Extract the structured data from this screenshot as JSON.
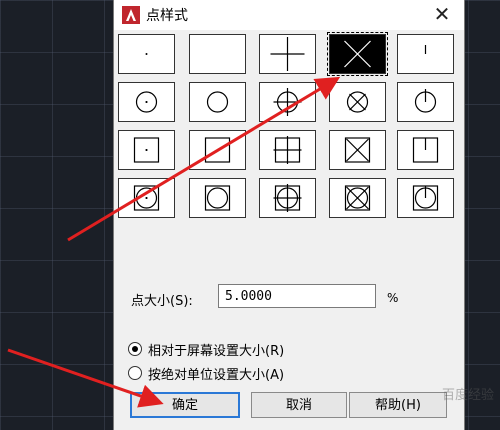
{
  "dialog": {
    "title": "点样式",
    "close_glyph": "✕",
    "icon": "autocad-logo-icon",
    "brand_color": "#c0262d"
  },
  "point_styles": [
    {
      "style": "dot",
      "selected": false
    },
    {
      "style": "none",
      "selected": false
    },
    {
      "style": "plus",
      "selected": false
    },
    {
      "style": "x",
      "selected": true
    },
    {
      "style": "tick",
      "selected": false
    },
    {
      "style": "circle-dot",
      "selected": false
    },
    {
      "style": "circle",
      "selected": false
    },
    {
      "style": "circle-plus",
      "selected": false
    },
    {
      "style": "circle-x",
      "selected": false
    },
    {
      "style": "circle-tick",
      "selected": false
    },
    {
      "style": "square-dot",
      "selected": false
    },
    {
      "style": "square",
      "selected": false
    },
    {
      "style": "square-plus",
      "selected": false
    },
    {
      "style": "square-x",
      "selected": false
    },
    {
      "style": "square-tick",
      "selected": false
    },
    {
      "style": "square-circle-dot",
      "selected": false
    },
    {
      "style": "square-circle",
      "selected": false
    },
    {
      "style": "square-circle-plus",
      "selected": false
    },
    {
      "style": "square-circle-x",
      "selected": false
    },
    {
      "style": "square-circle-tick",
      "selected": false
    }
  ],
  "size": {
    "label": "点大小(S):",
    "value": "5.0000",
    "unit": "%"
  },
  "mode": {
    "relative_label": "相对于屏幕设置大小(R)",
    "absolute_label": "按绝对单位设置大小(A)",
    "selected": "relative"
  },
  "buttons": {
    "ok": "确定",
    "cancel": "取消",
    "help": "帮助(H)"
  },
  "watermark": "百度经验",
  "annotation_color": "#e02020"
}
